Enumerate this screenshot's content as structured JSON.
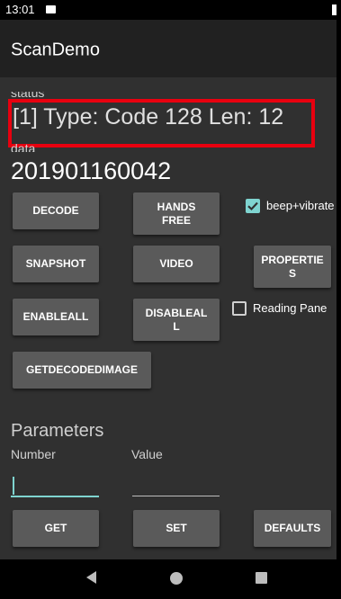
{
  "statusbar": {
    "time": "13:01"
  },
  "appbar": {
    "title": "ScanDemo"
  },
  "status": {
    "label": "status",
    "text": "[1]   Type: Code 128   Len: 12"
  },
  "data": {
    "label": "data",
    "value": "201901160042"
  },
  "buttons": {
    "decode": "DECODE",
    "hands_free": "HANDS\nFREE",
    "snapshot": "SNAPSHOT",
    "video": "VIDEO",
    "properties": "PROPERTIE\nS",
    "enableall": "ENABLEALL",
    "disableall": "DISABLEAL\nL",
    "getdecodedimage": "GETDECODEDIMAGE",
    "get": "GET",
    "set": "SET",
    "defaults": "DEFAULTS"
  },
  "checkboxes": {
    "beep_vibrate": {
      "label": "beep+vibrate",
      "checked": true
    },
    "reading_pane": {
      "label": "Reading Pane",
      "checked": false
    }
  },
  "parameters": {
    "title": "Parameters",
    "number_label": "Number",
    "number_value": "",
    "value_label": "Value",
    "value_value": ""
  },
  "colors": {
    "highlight": "#e8000f",
    "accent": "#7fd4d0",
    "background": "#303030",
    "appbar": "#212121"
  }
}
